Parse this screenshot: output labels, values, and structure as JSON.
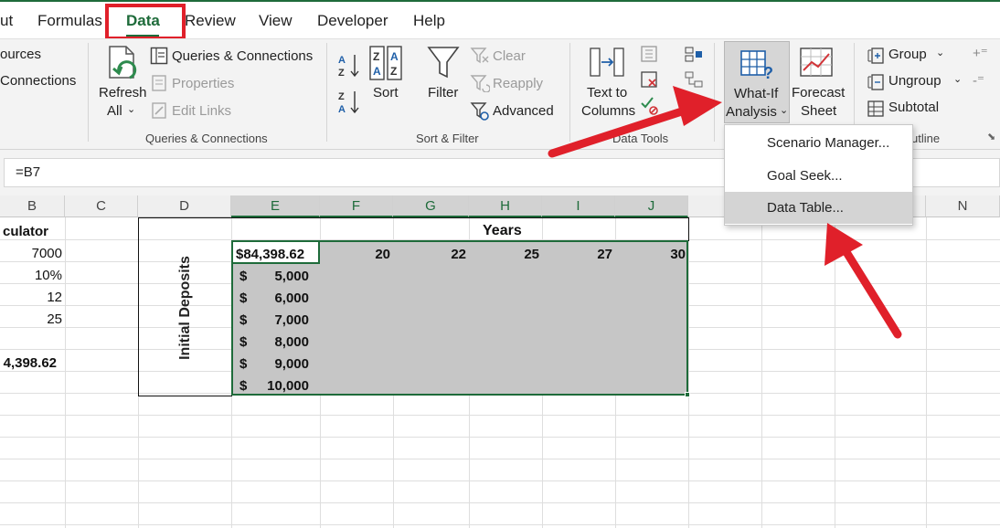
{
  "tabs": [
    {
      "label": "ut"
    },
    {
      "label": "Formulas"
    },
    {
      "label": "Data"
    },
    {
      "label": "Review"
    },
    {
      "label": "View"
    },
    {
      "label": "Developer"
    },
    {
      "label": "Help"
    }
  ],
  "ribbon": {
    "get_data": {
      "sources_label": "ources",
      "connections_label": "Connections"
    },
    "queries": {
      "refresh_line1": "Refresh",
      "refresh_line2": "All",
      "queries_connections": "Queries & Connections",
      "properties": "Properties",
      "edit_links": "Edit Links",
      "group_label": "Queries & Connections"
    },
    "sort_filter": {
      "sort": "Sort",
      "filter": "Filter",
      "clear": "Clear",
      "reapply": "Reapply",
      "advanced": "Advanced",
      "group_label": "Sort & Filter"
    },
    "data_tools": {
      "text_to_columns_line1": "Text to",
      "text_to_columns_line2": "Columns",
      "group_label": "Data Tools"
    },
    "forecast": {
      "whatif_line1": "What-If",
      "whatif_line2": "Analysis",
      "forecast_line1": "Forecast",
      "forecast_line2": "Sheet"
    },
    "outline": {
      "group": "Group",
      "ungroup": "Ungroup",
      "subtotal": "Subtotal",
      "group_label": "utline"
    }
  },
  "whatif_menu": {
    "items": [
      {
        "label": "Scenario Manager..."
      },
      {
        "label": "Goal Seek..."
      },
      {
        "label": "Data Table..."
      }
    ],
    "highlighted_item": "Data Table..."
  },
  "formula_bar": {
    "formula": "=B7"
  },
  "sheet": {
    "columns": [
      "B",
      "C",
      "D",
      "E",
      "F",
      "G",
      "H",
      "I",
      "J",
      "N"
    ],
    "selected_columns": [
      "E",
      "F",
      "G",
      "H",
      "I",
      "J"
    ],
    "col_b_values": [
      "culator",
      "7000",
      "10%",
      "12",
      "25",
      "4,398.62"
    ],
    "years_header": "Years",
    "years": [
      "20",
      "22",
      "25",
      "27",
      "30"
    ],
    "result_cell": "$84,398.62",
    "deposits_label": "Initial Deposits",
    "currency_symbol": "$",
    "deposits": [
      "5,000",
      "6,000",
      "7,000",
      "8,000",
      "9,000",
      "10,000"
    ]
  },
  "colors": {
    "excel_green": "#1e6b3a",
    "annotation_red": "#e0202a",
    "selection_gray": "#c6c6c6"
  }
}
